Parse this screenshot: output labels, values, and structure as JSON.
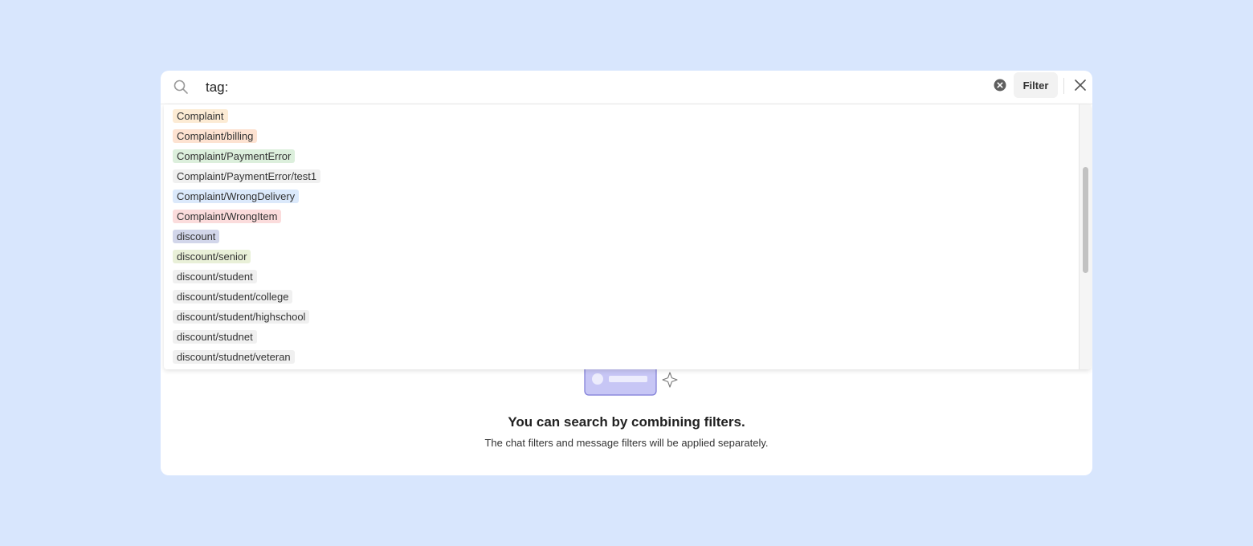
{
  "search": {
    "query": "tag:",
    "filter_label": "Filter",
    "icons": {
      "search": "search-icon",
      "clear": "clear-circle-icon",
      "close": "close-icon"
    }
  },
  "tags": [
    {
      "label": "Complaint",
      "color": "#fcebd4"
    },
    {
      "label": "Complaint/billing",
      "color": "#fde2d1"
    },
    {
      "label": "Complaint/PaymentError",
      "color": "#dcefdc"
    },
    {
      "label": "Complaint/PaymentError/test1",
      "color": "#f0f0f0"
    },
    {
      "label": "Complaint/WrongDelivery",
      "color": "#dbe9fb"
    },
    {
      "label": "Complaint/WrongItem",
      "color": "#fbdcdc"
    },
    {
      "label": "discount",
      "color": "#d2d6ea"
    },
    {
      "label": "discount/senior",
      "color": "#e9f0d8"
    },
    {
      "label": "discount/student",
      "color": "#f0f0f0"
    },
    {
      "label": "discount/student/college",
      "color": "#f0f0f0"
    },
    {
      "label": "discount/student/highschool",
      "color": "#f0f0f0"
    },
    {
      "label": "discount/studnet",
      "color": "#f0f0f0"
    },
    {
      "label": "discount/studnet/veteran",
      "color": "#f0f0f0"
    }
  ],
  "empty_state": {
    "title": "You can search by combining filters.",
    "subtitle": "The chat filters and message filters will be applied separately.",
    "illustration": "search-card-sparkle-illustration"
  },
  "colors": {
    "background": "#d8e6fd",
    "illustration_fill": "#c7c6f5",
    "illustration_stroke": "#7b79d6"
  }
}
